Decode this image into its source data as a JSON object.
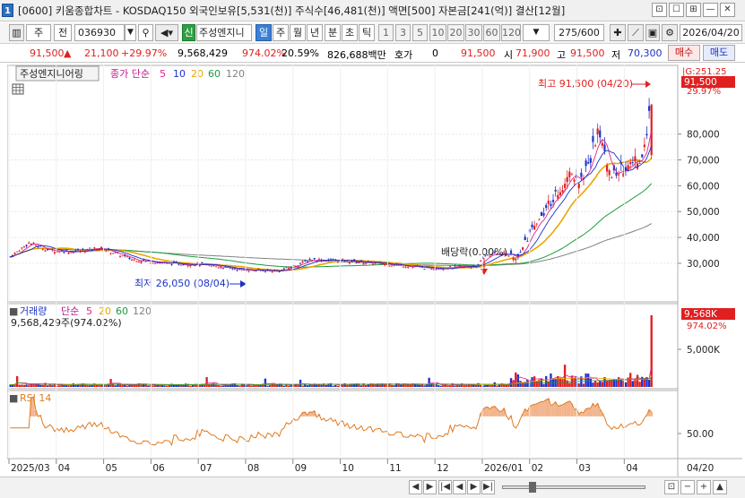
{
  "window": {
    "app_icon": "1",
    "title": "[0600] 키움종합차트 - KOSDAQ150 외국인보유[5,531(천)] 주식수[46,481(천)] 액면[500] 자본금[241(억)] 결산[12월]",
    "buttons": [
      "⊡",
      "☐",
      "⊞",
      "—",
      "✕"
    ]
  },
  "toolbar": {
    "layout_icon": "▥",
    "period_type": "주",
    "price_type": "전",
    "code": "036930",
    "search_icon": "search-icon",
    "name_tag": "신",
    "stock_name": "주성엔지니",
    "tabs": [
      "일",
      "주",
      "월",
      "년",
      "분",
      "초",
      "틱"
    ],
    "active_tab": "일",
    "intervals": [
      "1",
      "3",
      "5",
      "10",
      "20",
      "30",
      "60",
      "120"
    ],
    "count": "275/600",
    "date": "2026/04/20"
  },
  "quote": {
    "price": "91,500",
    "arrow": "▲",
    "change": "21,100",
    "change_pct": "+29.97%",
    "volume": "9,568,429",
    "vol_pct": "974.02%",
    "turnover": "20.59%",
    "amount": "826,688백만",
    "hoga_label": "호가",
    "hoga_value": "0",
    "ask": "91,500",
    "open_label": "시",
    "open": "71,900",
    "high_label": "고",
    "high": "91,500",
    "low_label": "저",
    "low": "70,300",
    "buy": "매수",
    "sell": "매도"
  },
  "price_panel": {
    "name": "주성엔지니어링",
    "ma_label": "종가 단순",
    "ma_periods": [
      "5",
      "10",
      "20",
      "60",
      "120"
    ],
    "ma_colors": [
      "#e0218a",
      "#1d33c9",
      "#e8a800",
      "#1e9a3c",
      "#808080"
    ],
    "axis_top": "|G:251.25",
    "last_price": "91,500",
    "last_pct": "29.97%",
    "high_note": "최고 91,500 (04/20)",
    "low_note": "최저 26,050 (08/04)",
    "event_note": "배당락(0.00%)",
    "y_ticks": [
      "80,000",
      "70,000",
      "60,000",
      "50,000",
      "40,000",
      "30,000"
    ],
    "up_color": "#e02020",
    "down_color": "#1d33c9"
  },
  "volume_panel": {
    "label": "거래량",
    "ma_label": "단순",
    "ma_periods": [
      "5",
      "20",
      "60",
      "120"
    ],
    "value_line": "9,568,429주(974.02%)",
    "axis_value": "9,568K",
    "axis_pct": "974.02%",
    "y_ticks": [
      "5,000K"
    ]
  },
  "rsi_panel": {
    "label": "RSI 14",
    "y_ticks": [
      "50.00"
    ],
    "color": "#e07a20"
  },
  "x_axis": {
    "labels": [
      "2025/03",
      "04",
      "05",
      "06",
      "07",
      "08",
      "09",
      "10",
      "11",
      "12",
      "2026/01",
      "02",
      "03",
      "04"
    ],
    "end_label": "04/20"
  },
  "bottom": {
    "buttons": [
      "◀",
      "▶",
      "|◀",
      "◀",
      "▶",
      "▶|",
      "⊡",
      "−",
      "+",
      "▲"
    ]
  },
  "chart_data": {
    "type": "candlestick",
    "title": "주성엔지니어링",
    "x_range": [
      "2025/03",
      "2026/04/20"
    ],
    "y_range_price": [
      22000,
      100000
    ],
    "price_path": [
      [
        0,
        32500
      ],
      [
        0.03,
        38000
      ],
      [
        0.06,
        35000
      ],
      [
        0.1,
        34500
      ],
      [
        0.14,
        36000
      ],
      [
        0.19,
        31500
      ],
      [
        0.24,
        30000
      ],
      [
        0.3,
        29500
      ],
      [
        0.36,
        27500
      ],
      [
        0.42,
        27000
      ],
      [
        0.47,
        31500
      ],
      [
        0.52,
        31000
      ],
      [
        0.57,
        30000
      ],
      [
        0.62,
        29000
      ],
      [
        0.65,
        28000
      ],
      [
        0.7,
        28500
      ],
      [
        0.73,
        29000
      ],
      [
        0.74,
        33000
      ],
      [
        0.77,
        34000
      ],
      [
        0.79,
        31500
      ],
      [
        0.8,
        37000
      ],
      [
        0.82,
        46000
      ],
      [
        0.84,
        53000
      ],
      [
        0.86,
        60000
      ],
      [
        0.875,
        66000
      ],
      [
        0.89,
        62000
      ],
      [
        0.905,
        71000
      ],
      [
        0.915,
        80000
      ],
      [
        0.925,
        74000
      ],
      [
        0.94,
        64000
      ],
      [
        0.955,
        67000
      ],
      [
        0.965,
        70000
      ],
      [
        0.975,
        70300
      ],
      [
        0.985,
        71900
      ],
      [
        1,
        91500
      ]
    ],
    "ma_levels": {
      "ma20_end": 68000,
      "ma60_end": 57500,
      "ma120_end": 43000
    },
    "volume_peak": "9,568K",
    "rsi_end": 64,
    "high": {
      "value": 91500,
      "date": "04/20"
    },
    "low": {
      "value": 26050,
      "date": "08/04"
    }
  }
}
